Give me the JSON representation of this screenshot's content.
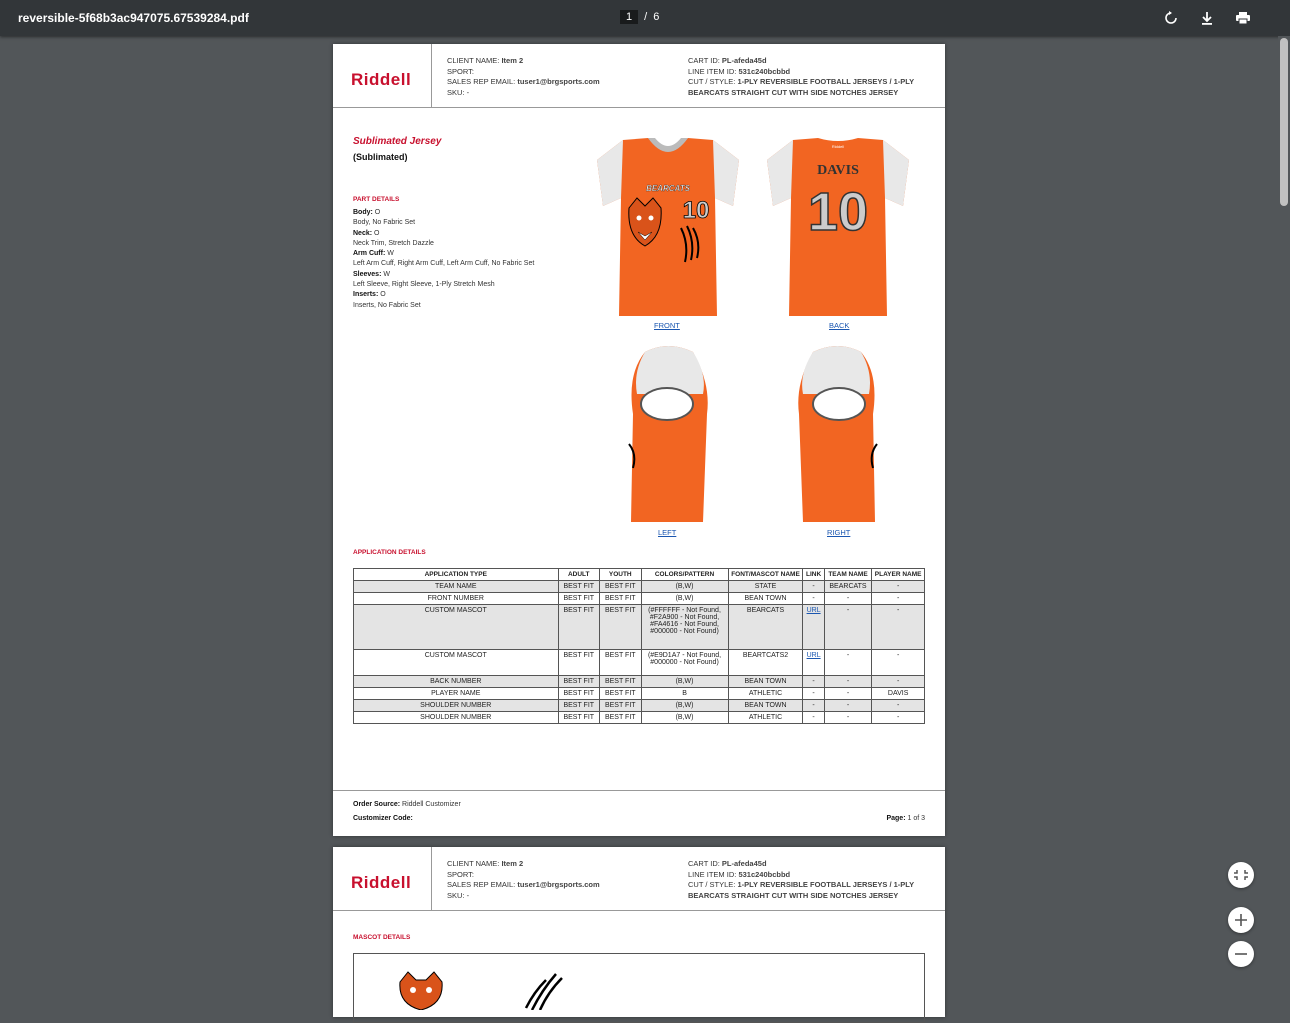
{
  "toolbar": {
    "title": "reversible-5f68b3ac947075.67539284.pdf",
    "current_page": "1",
    "separator": "/",
    "total_pages": "6"
  },
  "header": {
    "logo": "Riddell",
    "client_label": "CLIENT NAME:",
    "client_value": "Item 2",
    "sport_label": "SPORT:",
    "rep_label": "SALES REP EMAIL:",
    "rep_value": "tuser1@brgsports.com",
    "sku_label": "SKU:",
    "sku_value": "-",
    "cart_label": "CART ID:",
    "cart_value": "PL-afeda45d",
    "line_label": "LINE ITEM ID:",
    "line_value": "531c240bcbbd",
    "cut_label": "CUT / STYLE:",
    "cut_value": "1-PLY REVERSIBLE FOOTBALL JERSEYS / 1-PLY BEARCATS STRAIGHT CUT WITH SIDE NOTCHES JERSEY"
  },
  "product": {
    "title": "Sublimated Jersey",
    "subtitle": "(Sublimated)"
  },
  "part_details": {
    "heading": "PART DETAILS",
    "rows": [
      {
        "label": "Body:",
        "value": "O",
        "desc": "Body, No Fabric Set"
      },
      {
        "label": "Neck:",
        "value": "O",
        "desc": "Neck Trim, Stretch Dazzle"
      },
      {
        "label": "Arm Cuff:",
        "value": "W",
        "desc": "Left Arm Cuff, Right Arm Cuff, Left Arm Cuff, No Fabric Set"
      },
      {
        "label": "Sleeves:",
        "value": "W",
        "desc": "Left Sleeve, Right Sleeve, 1-Ply Stretch Mesh"
      },
      {
        "label": "Inserts:",
        "value": "O",
        "desc": "Inserts, No Fabric Set"
      }
    ]
  },
  "views": {
    "front": "FRONT",
    "back": "BACK",
    "left": "LEFT",
    "right": "RIGHT"
  },
  "jersey": {
    "team_text": "BEARCATS",
    "number": "10",
    "player_name": "DAVIS",
    "brand_tag": "Riddell",
    "colors": {
      "orange": "#f26522",
      "dark_orange": "#d9531a",
      "white": "#ffffff",
      "gray": "#c9c9c9",
      "black": "#000000"
    }
  },
  "application": {
    "heading": "APPLICATION DETAILS",
    "columns": [
      "APPLICATION TYPE",
      "ADULT",
      "YOUTH",
      "COLORS/PATTERN",
      "FONT/MASCOT NAME",
      "LINK",
      "TEAM NAME",
      "PLAYER NAME"
    ],
    "rows": [
      [
        "TEAM NAME",
        "BEST FIT",
        "BEST FIT",
        "(B,W)",
        "STATE",
        "-",
        "BEARCATS",
        "-"
      ],
      [
        "FRONT NUMBER",
        "BEST FIT",
        "BEST FIT",
        "(B,W)",
        "BEAN TOWN",
        "-",
        "-",
        "-"
      ],
      [
        "CUSTOM MASCOT",
        "BEST FIT",
        "BEST FIT",
        "(#FFFFFF - Not Found, #F2A900 - Not Found, #FA4616 - Not Found, #000000 - Not Found)",
        "BEARCATS",
        "URL",
        "-",
        "-"
      ],
      [
        "CUSTOM MASCOT",
        "BEST FIT",
        "BEST FIT",
        "(#E9D1A7 - Not Found, #000000 - Not Found)",
        "BEARTCATS2",
        "URL",
        "-",
        "-"
      ],
      [
        "BACK NUMBER",
        "BEST FIT",
        "BEST FIT",
        "(B,W)",
        "BEAN TOWN",
        "-",
        "-",
        "-"
      ],
      [
        "PLAYER NAME",
        "BEST FIT",
        "BEST FIT",
        "B",
        "ATHLETIC",
        "-",
        "-",
        "DAVIS"
      ],
      [
        "SHOULDER NUMBER",
        "BEST FIT",
        "BEST FIT",
        "(B,W)",
        "BEAN TOWN",
        "-",
        "-",
        "-"
      ],
      [
        "SHOULDER NUMBER",
        "BEST FIT",
        "BEST FIT",
        "(B,W)",
        "ATHLETIC",
        "-",
        "-",
        "-"
      ]
    ]
  },
  "footer": {
    "source_label": "Order Source:",
    "source_value": "Riddell Customizer",
    "code_label": "Customizer Code:",
    "page_label": "Page:",
    "page_value": "1 of 3"
  },
  "page2": {
    "heading": "MASCOT DETAILS"
  }
}
